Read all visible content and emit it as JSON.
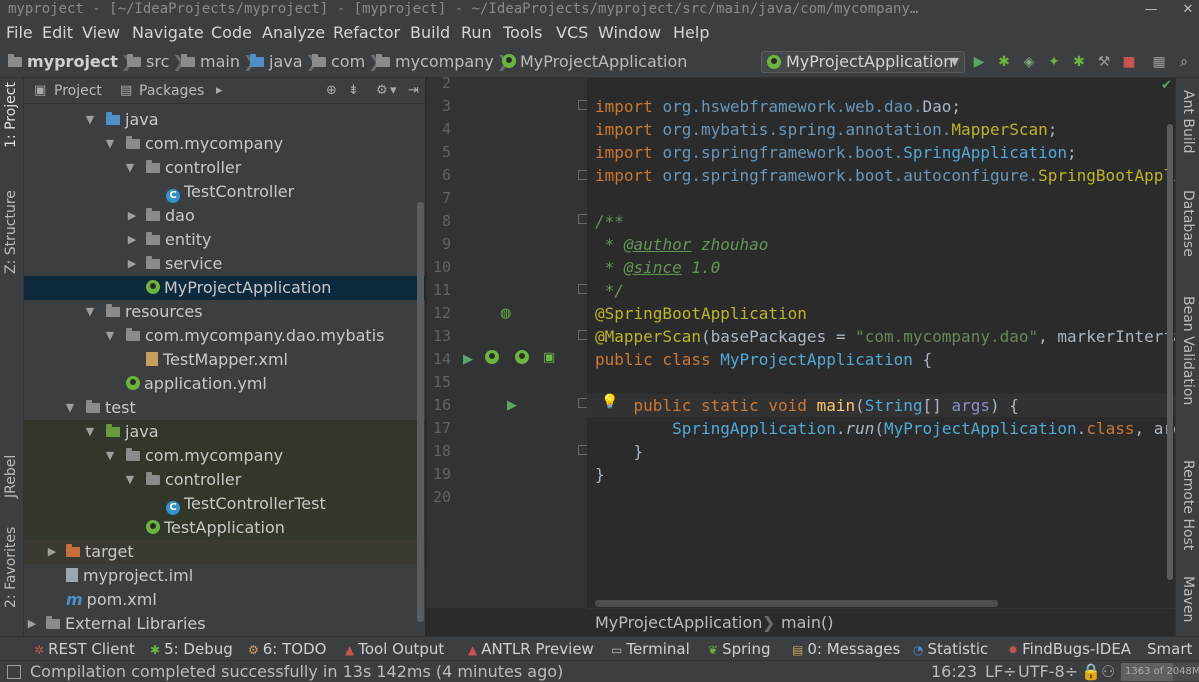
{
  "window": {
    "title": "myproject - [~/IdeaProjects/myproject] - [myproject] - ~/IdeaProjects/myproject/src/main/java/com/mycompany…"
  },
  "menu": [
    "File",
    "Edit",
    "View",
    "Navigate",
    "Code",
    "Analyze",
    "Refactor",
    "Build",
    "Run",
    "Tools",
    "VCS",
    "Window",
    "Help"
  ],
  "breadcrumb": [
    "myproject",
    "src",
    "main",
    "java",
    "com",
    "mycompany",
    "MyProjectApplication"
  ],
  "run_config": {
    "label": "MyProjectApplication"
  },
  "toolbar_icons": [
    "run-icon",
    "debug-icon",
    "coverage-icon",
    "jrebel-run-icon",
    "jrebel-debug-icon",
    "build-icon",
    "stop-icon",
    "project-structure-icon",
    "search-icon"
  ],
  "left_tool_tabs": [
    "1: Project",
    "Z: Structure",
    "JRebel",
    "2: Favorites"
  ],
  "right_tool_tabs": [
    "Ant Build",
    "Database",
    "Bean Validation",
    "Remote Host",
    "Maven"
  ],
  "project_panel": {
    "header": {
      "project_tab": "Project",
      "packages_tab": "Packages"
    },
    "tree": [
      {
        "label": "java",
        "icon": "folder-blue",
        "arrow": "▼"
      },
      {
        "label": "com.mycompany",
        "icon": "package",
        "arrow": "▼"
      },
      {
        "label": "controller",
        "icon": "package",
        "arrow": "▼"
      },
      {
        "label": "TestController",
        "icon": "class",
        "arrow": ""
      },
      {
        "label": "dao",
        "icon": "package",
        "arrow": "▶"
      },
      {
        "label": "entity",
        "icon": "package",
        "arrow": "▶"
      },
      {
        "label": "service",
        "icon": "package",
        "arrow": "▶"
      },
      {
        "label": "MyProjectApplication",
        "icon": "spring-class",
        "arrow": "",
        "selected": true
      },
      {
        "label": "resources",
        "icon": "folder-resources",
        "arrow": "▼"
      },
      {
        "label": "com.mycompany.dao.mybatis",
        "icon": "package",
        "arrow": "▼"
      },
      {
        "label": "TestMapper.xml",
        "icon": "xml-file",
        "arrow": ""
      },
      {
        "label": "application.yml",
        "icon": "spring-config",
        "arrow": ""
      },
      {
        "label": "test",
        "icon": "folder",
        "arrow": "▼"
      },
      {
        "label": "java",
        "icon": "folder-green",
        "arrow": "▼"
      },
      {
        "label": "com.mycompany",
        "icon": "package",
        "arrow": "▼"
      },
      {
        "label": "controller",
        "icon": "package",
        "arrow": "▼"
      },
      {
        "label": "TestControllerTest",
        "icon": "class",
        "arrow": ""
      },
      {
        "label": "TestApplication",
        "icon": "spring-class",
        "arrow": ""
      },
      {
        "label": "target",
        "icon": "folder-orange",
        "arrow": "▶"
      },
      {
        "label": "myproject.iml",
        "icon": "iml-file",
        "arrow": ""
      },
      {
        "label": "pom.xml",
        "icon": "maven",
        "arrow": ""
      },
      {
        "label": "External Libraries",
        "icon": "libraries",
        "arrow": "▶"
      }
    ]
  },
  "editor": {
    "line_numbers": [
      "2",
      "3",
      "4",
      "5",
      "6",
      "7",
      "8",
      "9",
      "10",
      "11",
      "12",
      "13",
      "14",
      "15",
      "16",
      "17",
      "18",
      "19",
      "20"
    ],
    "breadcrumb": {
      "class": "MyProjectApplication",
      "method": "main()"
    }
  },
  "bottom_tabs": [
    "REST Client",
    "5: Debug",
    "6: TODO",
    "Tool Output",
    "ANTLR Preview",
    "Terminal",
    "Spring",
    "0: Messages",
    "Statistic",
    "FindBugs-IDEA",
    "Smart"
  ],
  "status": {
    "message": "Compilation completed successfully in 13s 142ms (4 minutes ago)",
    "position": "16:23",
    "line_sep": "LF÷",
    "encoding": "UTF-8÷",
    "memory": "1363 of 2048M",
    "memory_fraction": 0.665
  }
}
